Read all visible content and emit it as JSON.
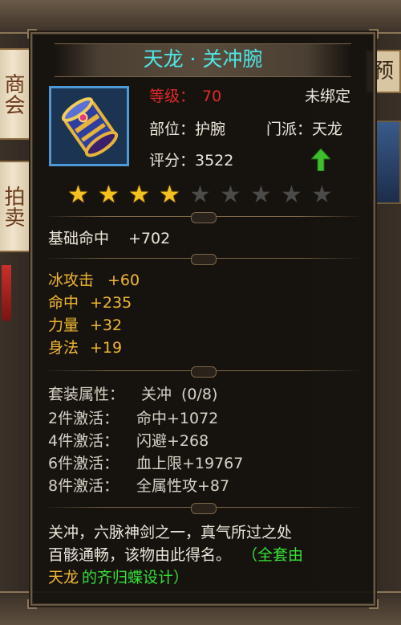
{
  "background": {
    "lantern_top": "商会",
    "lantern_bottom": "拍卖",
    "right_tab": "预"
  },
  "item": {
    "name": "天龙 · 关冲腕",
    "icon": "bracer-icon",
    "level_label": "等级：",
    "level_value": "70",
    "bind_status": "未绑定",
    "slot": "部位：护腕",
    "sect": "门派：天龙",
    "score": "评分：3522",
    "upgrade_indicator": "green-up-arrow-icon",
    "stars_filled": 4,
    "stars_total": 9
  },
  "base_stat": {
    "label": "基础命中",
    "value": "+702"
  },
  "extra_stats": [
    {
      "label": "冰攻击",
      "value": "+60"
    },
    {
      "label": "命中",
      "value": "+235"
    },
    {
      "label": "力量",
      "value": "+32"
    },
    {
      "label": "身法",
      "value": "+19"
    }
  ],
  "set": {
    "header_label": "套装属性：",
    "header_name": "关冲",
    "header_count": "(0/8)",
    "bonuses": [
      {
        "label": "2件激活：",
        "value": "命中+1072"
      },
      {
        "label": "4件激活：",
        "value": "闪避+268"
      },
      {
        "label": "6件激活：",
        "value": "血上限+19767"
      },
      {
        "label": "8件激活：",
        "value": "全属性攻+87"
      }
    ]
  },
  "description": {
    "line1": "关冲，六脉神剑之一，真气所过之处",
    "line2_a": "百骸通畅，该物由此得名。",
    "line2_b": "（全套由",
    "line3_a": "天龙",
    "line3_b": "的齐归蝶设计）"
  },
  "colors": {
    "title": "#4fe6e6",
    "level": "#e02a2a",
    "gold_stat": "#f0b830",
    "green_text": "#35e035"
  }
}
